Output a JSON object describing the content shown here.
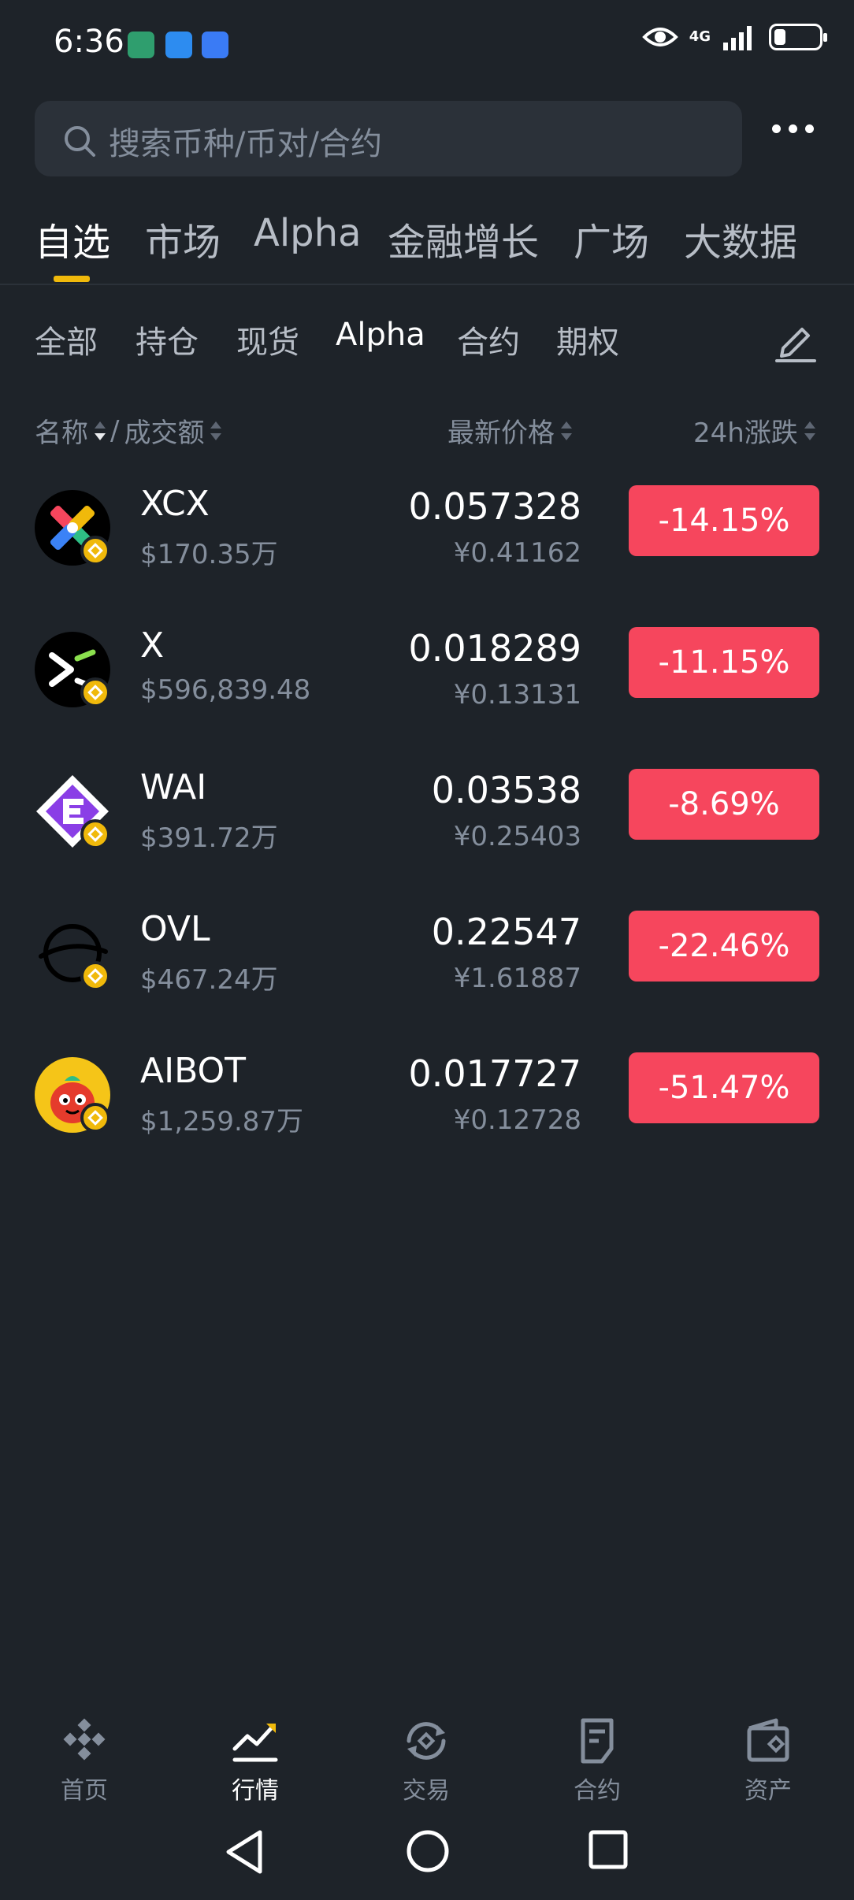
{
  "status_bar": {
    "time": "6:36",
    "network": "4G"
  },
  "search": {
    "placeholder": "搜索币种/币对/合约"
  },
  "main_tabs": [
    "自选",
    "市场",
    "Alpha",
    "金融增长",
    "广场",
    "大数据"
  ],
  "sub_tabs": [
    "全部",
    "持仓",
    "现货",
    "Alpha",
    "合约",
    "期权"
  ],
  "header": {
    "name": "名称",
    "sep": "/",
    "volume": "成交额",
    "price": "最新价格",
    "change": "24h涨跌"
  },
  "rows": [
    {
      "symbol": "XCX",
      "volume": "$170.35万",
      "price": "0.057328",
      "cny": "¥0.41162",
      "change": "-14.15%",
      "logo": "xcx-logo-icon"
    },
    {
      "symbol": "X",
      "volume": "$596,839.48",
      "price": "0.018289",
      "cny": "¥0.13131",
      "change": "-11.15%",
      "logo": "x-logo-icon"
    },
    {
      "symbol": "WAI",
      "volume": "$391.72万",
      "price": "0.03538",
      "cny": "¥0.25403",
      "change": "-8.69%",
      "logo": "wai-logo-icon"
    },
    {
      "symbol": "OVL",
      "volume": "$467.24万",
      "price": "0.22547",
      "cny": "¥1.61887",
      "change": "-22.46%",
      "logo": "ovl-logo-icon"
    },
    {
      "symbol": "AIBOT",
      "volume": "$1,259.87万",
      "price": "0.017727",
      "cny": "¥0.12728",
      "change": "-51.47%",
      "logo": "aibot-logo-icon"
    }
  ],
  "bottom_nav": [
    "首页",
    "行情",
    "交易",
    "合约",
    "资产"
  ],
  "colors": {
    "background": "#1e2329",
    "accent": "#f0b90b",
    "down": "#f6465d"
  }
}
